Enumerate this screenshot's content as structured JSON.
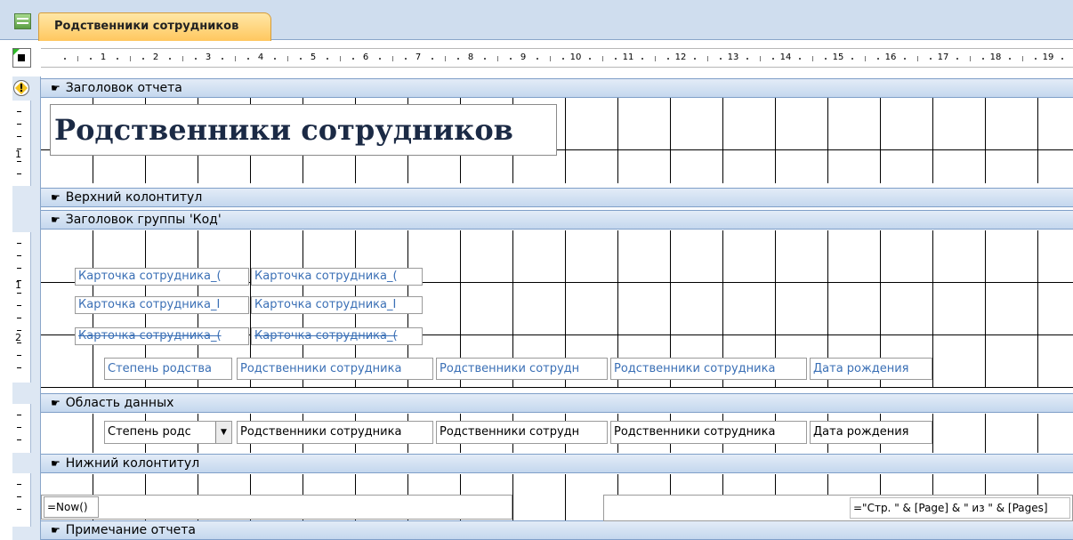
{
  "tab": {
    "title": "Родственники сотрудников"
  },
  "ruler": {
    "marks": [
      "1",
      "2",
      "3",
      "4",
      "5",
      "6",
      "7",
      "8",
      "9",
      "10",
      "11",
      "12",
      "13",
      "14",
      "15",
      "16",
      "17",
      "18",
      "19"
    ]
  },
  "vruler": {
    "report_header": [
      "1"
    ],
    "group_header": [
      "1",
      "2"
    ]
  },
  "sections": {
    "report_header": "Заголовок отчета",
    "page_header": "Верхний колонтитул",
    "group_header": "Заголовок группы 'Код'",
    "detail": "Область данных",
    "page_footer": "Нижний колонтитул",
    "report_footer": "Примечание отчета"
  },
  "report_title": "Родственники сотрудников",
  "group_header": {
    "card_labels": [
      [
        "Карточка сотрудника_(",
        "Карточка сотрудника_("
      ],
      [
        "Карточка сотрудника_I",
        "Карточка сотрудника_I"
      ],
      [
        "Карточка сотрудника_(",
        "Карточка сотрудника_("
      ]
    ],
    "column_labels": [
      "Степень родства",
      "Родственники сотрудника",
      "Родственники сотрудн",
      "Родственники сотрудника",
      "Дата рождения"
    ]
  },
  "detail": {
    "fields": [
      "Степень родс",
      "Родственники сотрудника",
      "Родственники сотрудн",
      "Родственники сотрудника",
      "Дата рождения"
    ]
  },
  "page_footer": {
    "now_expr": "=Now()",
    "page_expr": "=\"Стр. \" & [Page] & \" из \" & [Pages]"
  },
  "icons": {
    "section_marker": "pointing-hand-icon",
    "warning": "warning-icon",
    "form_tab": "report-icon"
  }
}
